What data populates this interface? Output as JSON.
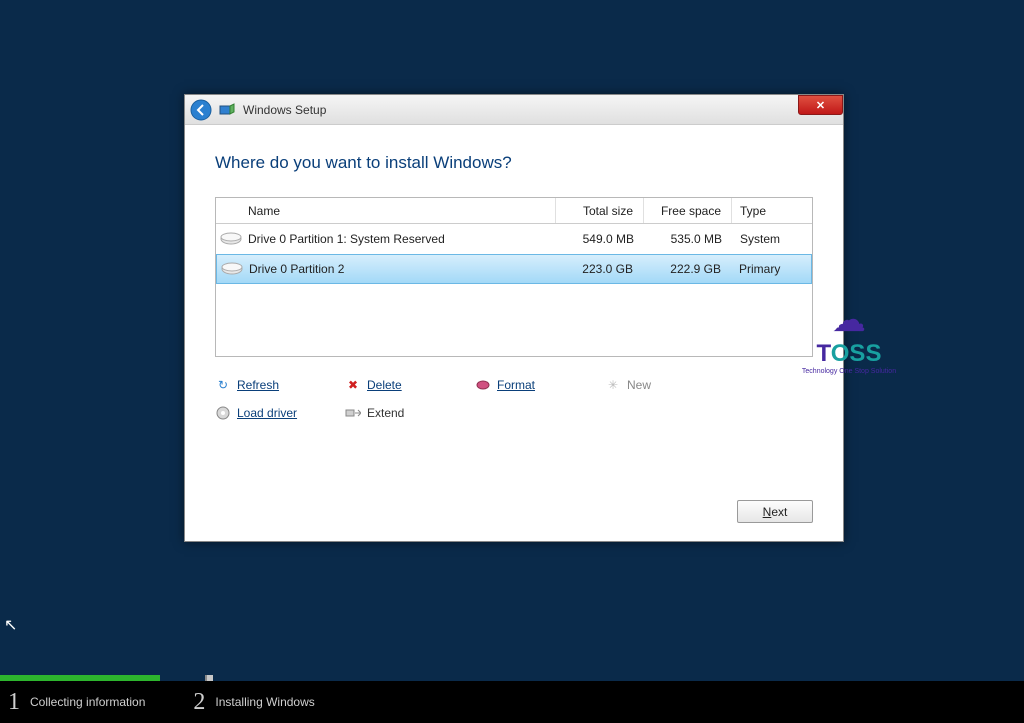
{
  "window": {
    "title": "Windows Setup",
    "heading": "Where do you want to install Windows?"
  },
  "table": {
    "headers": {
      "name": "Name",
      "total_size": "Total size",
      "free_space": "Free space",
      "type": "Type"
    },
    "rows": [
      {
        "name": "Drive 0 Partition 1: System Reserved",
        "total_size": "549.0 MB",
        "free_space": "535.0 MB",
        "type": "System",
        "selected": false
      },
      {
        "name": "Drive 0 Partition 2",
        "total_size": "223.0 GB",
        "free_space": "222.9 GB",
        "type": "Primary",
        "selected": true
      }
    ]
  },
  "actions": {
    "refresh": "Refresh",
    "delete": "Delete",
    "format": "Format",
    "new": "New",
    "load_driver": "Load driver",
    "extend": "Extend"
  },
  "buttons": {
    "next": "Next"
  },
  "steps": {
    "1": {
      "num": "1",
      "label": "Collecting information"
    },
    "2": {
      "num": "2",
      "label": "Installing Windows"
    }
  },
  "watermark": {
    "name": "TOSS",
    "tagline": "Technology One Stop Solution"
  }
}
